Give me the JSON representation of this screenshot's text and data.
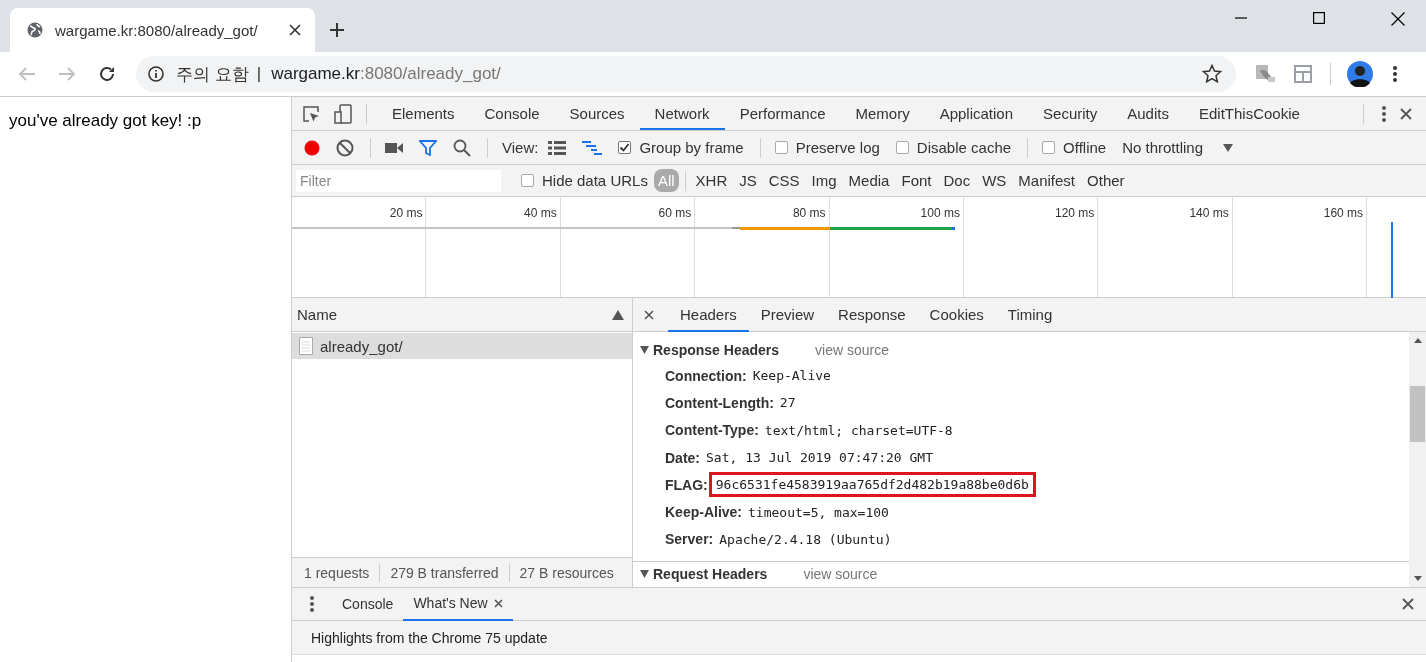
{
  "window": {
    "tab_title": "wargame.kr:8080/already_got/"
  },
  "address_bar": {
    "security_label": "주의 요함",
    "separator": "|",
    "host": "wargame.kr",
    "path": ":8080/already_got/"
  },
  "page": {
    "text": "you've already got key! :p"
  },
  "devtools": {
    "tabs": [
      {
        "label": "Elements",
        "selected": false
      },
      {
        "label": "Console",
        "selected": false
      },
      {
        "label": "Sources",
        "selected": false
      },
      {
        "label": "Network",
        "selected": true
      },
      {
        "label": "Performance",
        "selected": false
      },
      {
        "label": "Memory",
        "selected": false
      },
      {
        "label": "Application",
        "selected": false
      },
      {
        "label": "Security",
        "selected": false
      },
      {
        "label": "Audits",
        "selected": false
      },
      {
        "label": "EditThisCookie",
        "selected": false
      }
    ],
    "toolbar": {
      "recording": true,
      "view_label": "View:",
      "options": [
        {
          "label": "Group by frame",
          "checked": true,
          "divider_before": false
        },
        {
          "label": "Preserve log",
          "checked": false,
          "divider_before": true
        },
        {
          "label": "Disable cache",
          "checked": false,
          "divider_before": false
        },
        {
          "label": "Offline",
          "checked": false,
          "divider_before": true
        }
      ],
      "throttling": "No throttling"
    },
    "filter": {
      "placeholder": "Filter",
      "hide_data_urls": {
        "label": "Hide data URLs",
        "checked": false
      },
      "types": [
        {
          "label": "All",
          "selected": true
        },
        {
          "label": "XHR",
          "selected": false
        },
        {
          "label": "JS",
          "selected": false
        },
        {
          "label": "CSS",
          "selected": false
        },
        {
          "label": "Img",
          "selected": false
        },
        {
          "label": "Media",
          "selected": false
        },
        {
          "label": "Font",
          "selected": false
        },
        {
          "label": "Doc",
          "selected": false
        },
        {
          "label": "WS",
          "selected": false
        },
        {
          "label": "Manifest",
          "selected": false
        },
        {
          "label": "Other",
          "selected": false
        }
      ]
    },
    "overview": {
      "ticks": [
        "20 ms",
        "40 ms",
        "60 ms",
        "80 ms",
        "100 ms",
        "120 ms",
        "140 ms",
        "160 ms"
      ]
    },
    "requests": {
      "column": "Name",
      "rows": [
        {
          "name": "already_got/",
          "selected": true
        }
      ],
      "summary": [
        "1 requests",
        "279 B transferred",
        "27 B resources"
      ]
    },
    "details": {
      "tabs": [
        {
          "label": "Headers",
          "selected": true
        },
        {
          "label": "Preview",
          "selected": false
        },
        {
          "label": "Response",
          "selected": false
        },
        {
          "label": "Cookies",
          "selected": false
        },
        {
          "label": "Timing",
          "selected": false
        }
      ],
      "sections": [
        {
          "title": "Response Headers",
          "expanded": true,
          "link": "view source",
          "headers": [
            {
              "name": "Connection:",
              "value": "Keep-Alive",
              "highlighted": false
            },
            {
              "name": "Content-Length:",
              "value": "27",
              "highlighted": false
            },
            {
              "name": "Content-Type:",
              "value": "text/html; charset=UTF-8",
              "highlighted": false
            },
            {
              "name": "Date:",
              "value": "Sat, 13 Jul 2019 07:47:20 GMT",
              "highlighted": false
            },
            {
              "name": "FLAG:",
              "value": "96c6531fe4583919aa765df2d482b19a88be0d6b",
              "highlighted": true
            },
            {
              "name": "Keep-Alive:",
              "value": "timeout=5, max=100",
              "highlighted": false
            },
            {
              "name": "Server:",
              "value": "Apache/2.4.18 (Ubuntu)",
              "highlighted": false
            }
          ]
        },
        {
          "title": "Request Headers",
          "expanded": true,
          "link": "view source"
        }
      ]
    },
    "drawer": {
      "tabs": [
        {
          "label": "Console",
          "selected": false,
          "closable": false
        },
        {
          "label": "What's New",
          "selected": true,
          "closable": true
        }
      ],
      "text": "Highlights from the Chrome 75 update"
    }
  }
}
